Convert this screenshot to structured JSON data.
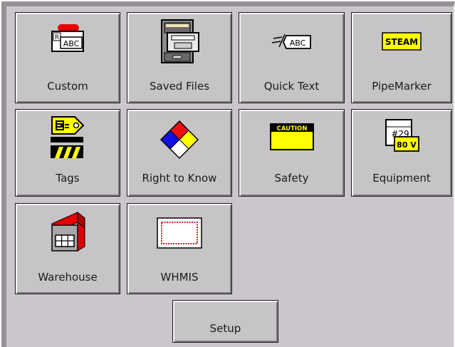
{
  "buttons": {
    "custom": {
      "label": "Custom",
      "icon": "label-abc-icon"
    },
    "saved_files": {
      "label": "Saved Files",
      "icon": "file-cabinet-icon"
    },
    "quick_text": {
      "label": "Quick Text",
      "icon": "quick-text-icon"
    },
    "pipemarker": {
      "label": "PipeMarker",
      "icon": "steam-pipe-marker-icon",
      "icon_text": "STEAM"
    },
    "tags": {
      "label": "Tags",
      "icon": "tag-icon"
    },
    "right_to_know": {
      "label": "Right to Know",
      "icon": "nfpa-diamond-icon"
    },
    "safety": {
      "label": "Safety",
      "icon": "caution-sign-icon",
      "icon_text": "CAUTION"
    },
    "equipment": {
      "label": "Equipment",
      "icon": "equipment-label-icon",
      "icon_text_top": "#29",
      "icon_text_bottom": "80 V"
    },
    "warehouse": {
      "label": "Warehouse",
      "icon": "warehouse-icon"
    },
    "whmis": {
      "label": "WHMIS",
      "icon": "whmis-border-icon"
    },
    "setup": {
      "label": "Setup"
    }
  },
  "colors": {
    "panel": "#cac6cb",
    "button_face": "#c7c4c8",
    "accent_yellow": "#ffff00",
    "accent_red": "#e81010"
  }
}
